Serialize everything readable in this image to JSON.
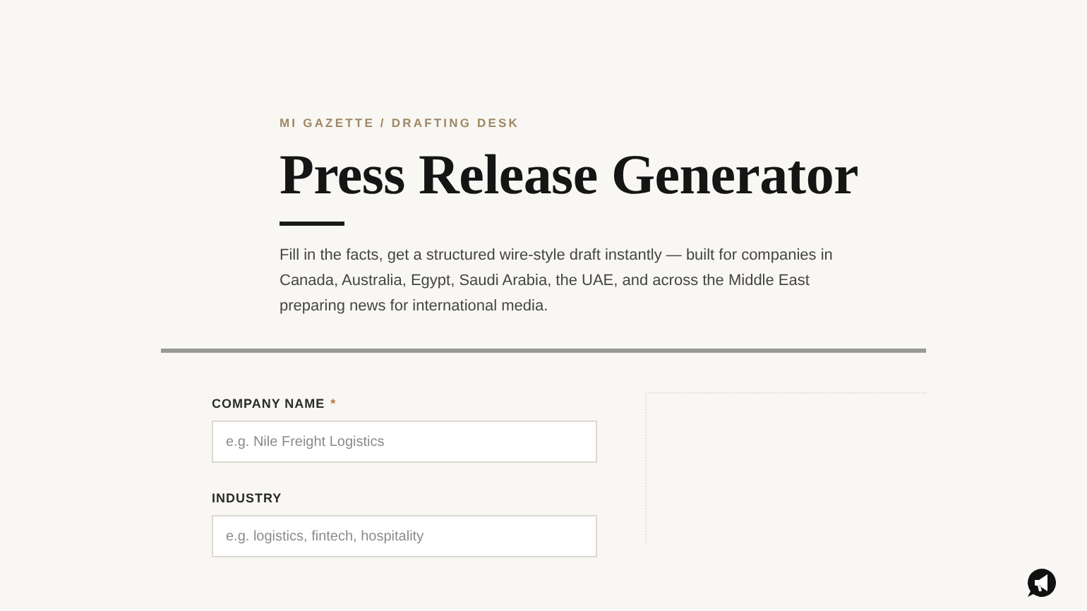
{
  "eyebrow": "MI GAZETTE / DRAFTING DESK",
  "title": "Press Release Generator",
  "intro": "Fill in the facts, get a structured wire-style draft instantly — built for companies in Canada, Australia, Egypt, Saudi Arabia, the UAE, and across the Middle East preparing news for international media.",
  "fields": [
    {
      "label": "COMPANY NAME",
      "required_mark": "*",
      "placeholder": "e.g. Nile Freight Logistics"
    },
    {
      "label": "INDUSTRY",
      "placeholder": "e.g. logistics, fintech, hospitality"
    }
  ]
}
